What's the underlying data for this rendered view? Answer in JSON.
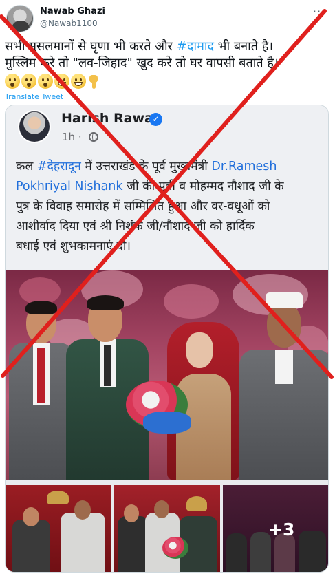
{
  "tweet": {
    "display_name": "Nawab Ghazi",
    "handle": "@Nawab1100",
    "text": {
      "line1_pre": "सभी मुसलमानों से घृणा भी करते और ",
      "line1_hashtag": "#दामाद",
      "line1_post": " भी बनाते है।",
      "line2": "मुस्लिम करे तो \"लव-जिहाद\" खुद करे तो घर वापसी बताते है।"
    },
    "emojis": [
      "astonished-face-icon",
      "astonished-face-icon",
      "astonished-face-icon",
      "grinning-face-icon",
      "grinning-face-icon",
      "backhand-index-pointing-down-icon"
    ],
    "translate_label": "Translate Tweet"
  },
  "embedded_post": {
    "author_name": "Harish Rawat",
    "verified_mark": "✓",
    "time": "1h ·",
    "text": {
      "line1_pre": "कल ",
      "line1_hashtag": "#देहरादून",
      "line1_post": " में उत्तराखंड के पूर्व मुख्यमंत्री ",
      "line1_name": "Dr.Ramesh",
      "line2_name": "Pokhriyal Nishank",
      "line2_post": " जी की पुत्री व मोहम्मद नौशाद जी के",
      "line3": "पुत्र के विवाह समारोह में सम्मिलित हुआ और वर-वधूओं को",
      "line4": "आशीर्वाद दिया एवं श्री निशंक जी/नौशाद जी को हार्दिक",
      "line5": "बधाई एवं शुभकामनाएं दी।"
    },
    "more_photos_label": "+3"
  },
  "colors": {
    "link_blue": "#1d9bf0",
    "facebook_blue": "#216fdb",
    "overlay_red": "#e0201d"
  }
}
